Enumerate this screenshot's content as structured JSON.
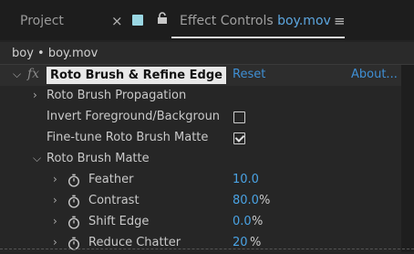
{
  "tabs": {
    "project_label": "Project",
    "close_glyph": "×",
    "effect_controls_label": "Effect Controls",
    "effect_controls_file": "boy.mov",
    "menu_glyph": "≡"
  },
  "breadcrumb": "boy • boy.mov",
  "effect": {
    "fx_glyph": "fx",
    "name": "Roto Brush & Refine Edge",
    "reset_label": "Reset",
    "about_label": "About..."
  },
  "rows": {
    "propagation": "Roto Brush Propagation",
    "invert_fg_bg": "Invert Foreground/Backgroun",
    "invert_checked": false,
    "finetune": "Fine-tune Roto Brush Matte",
    "finetune_checked": true,
    "matte_group": "Roto Brush Matte"
  },
  "params": [
    {
      "label": "Feather",
      "value": "10.0",
      "unit": ""
    },
    {
      "label": "Contrast",
      "value": "80.0",
      "unit": "%"
    },
    {
      "label": "Shift Edge",
      "value": "0.0",
      "unit": "%"
    },
    {
      "label": "Reduce Chatter",
      "value": "20",
      "unit": "%"
    }
  ],
  "colors": {
    "link": "#3f8fd4",
    "value": "#4aa3e4",
    "file_name": "#5ca6df"
  }
}
